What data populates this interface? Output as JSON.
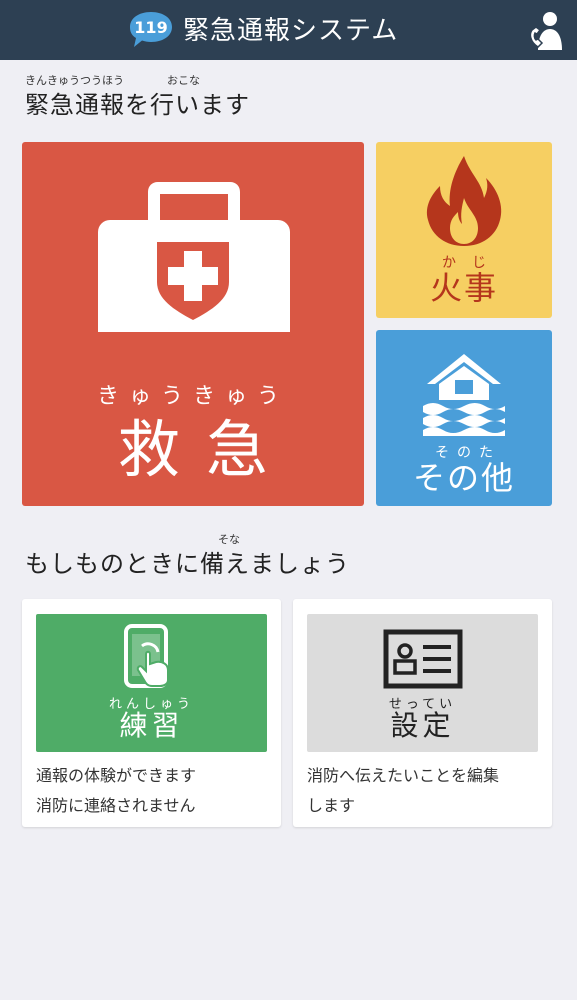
{
  "header": {
    "badge": "119",
    "title": "緊急通報システム",
    "profile_icon": "user-phone-icon"
  },
  "report_section": {
    "ruby_1": "きんきゅうつうほう",
    "ruby_2": "おこな",
    "title": "緊急通報を行います"
  },
  "tiles": {
    "ems": {
      "ruby": "きゅうきゅう",
      "label": "救急",
      "icon": "first-aid-kit-icon",
      "color": "#d95744"
    },
    "fire": {
      "ruby": "かじ",
      "label": "火事",
      "icon": "flame-icon",
      "color": "#f6cf62"
    },
    "other": {
      "ruby": "そのた",
      "label": "その他",
      "icon": "flood-house-icon",
      "color": "#4a9ed9"
    }
  },
  "prepare_section": {
    "ruby": "そな",
    "title": "もしものときに備えましょう"
  },
  "cards": {
    "practice": {
      "ruby": "れんしゅう",
      "label": "練習",
      "icon": "tablet-touch-icon",
      "desc_line1": "通報の体験ができます",
      "desc_line2": "消防に連絡されません",
      "color": "#4fac67"
    },
    "settings": {
      "ruby": "せってい",
      "label": "設定",
      "icon": "id-card-icon",
      "desc_line1": "消防へ伝えたいことを編集",
      "desc_line2": "します",
      "color": "#dcdcdc"
    }
  }
}
